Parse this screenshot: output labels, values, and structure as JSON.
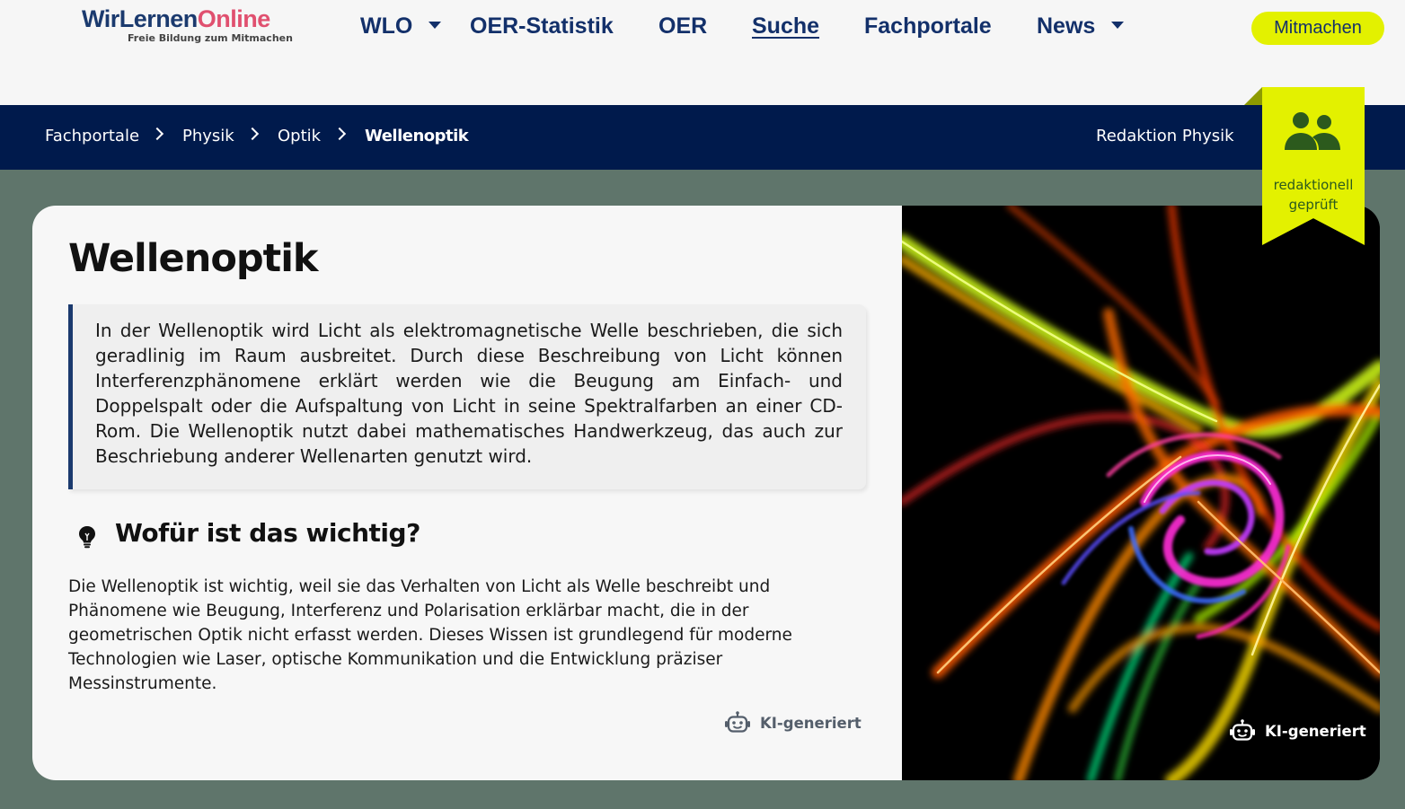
{
  "header": {
    "logo": {
      "part1": "WirLernen",
      "part2": "Online",
      "tagline": "Freie Bildung zum Mitmachen"
    },
    "nav": [
      {
        "label": "WLO",
        "has_dropdown": true
      },
      {
        "label": "OER-Statistik",
        "has_dropdown": false
      },
      {
        "label": "OER",
        "has_dropdown": false
      },
      {
        "label": "Suche",
        "has_dropdown": false,
        "active": true
      },
      {
        "label": "Fachportale",
        "has_dropdown": false
      },
      {
        "label": "News",
        "has_dropdown": true
      }
    ],
    "cta_label": "Mitmachen"
  },
  "breadcrumb": {
    "items": [
      "Fachportale",
      "Physik",
      "Optik"
    ],
    "current": "Wellenoptik",
    "editorial_link": "Redaktion Physik"
  },
  "badge": {
    "icon": "users-icon",
    "line1": "redaktionell",
    "line2": "geprüft"
  },
  "main": {
    "title": "Wellenoptik",
    "description": "In der Wellenoptik wird Licht als elektromagnetische Welle beschrieben, die sich geradlinig im Raum ausbreitet. Durch diese Beschreibung von Licht können Interferenzphänomene erklärt werden wie die Beugung am Einfach- und Doppelspalt oder die Aufspaltung von Licht in seine Spektralfarben an einer CD-Rom. Die Wellenoptik nutzt dabei mathematisches Handwerkzeug, das auch zur Beschriebung anderer Wellenarten genutzt wird.",
    "section_icon": "lightbulb-icon",
    "section_title": "Wofür ist das wichtig?",
    "section_text": "Die Wellenoptik ist wichtig, weil sie das Verhalten von Licht als Welle beschreibt und Phänomene wie Beugung, Interferenz und Polarisation erklärbar macht, die in der geometrischen Optik nicht erfasst werden. Dieses Wissen ist grundlegend für moderne Technologien wie Laser, optische Kommunikation und die Entwicklung präziser Messinstrumente.",
    "ai_label_text": "KI-generiert",
    "ai_label_image": "KI-generiert"
  },
  "colors": {
    "navy": "#001a4c",
    "nav_text": "#13306a",
    "accent_yellow": "#e3f100",
    "logo_red": "#e0506f",
    "page_bg": "#5f756b"
  }
}
